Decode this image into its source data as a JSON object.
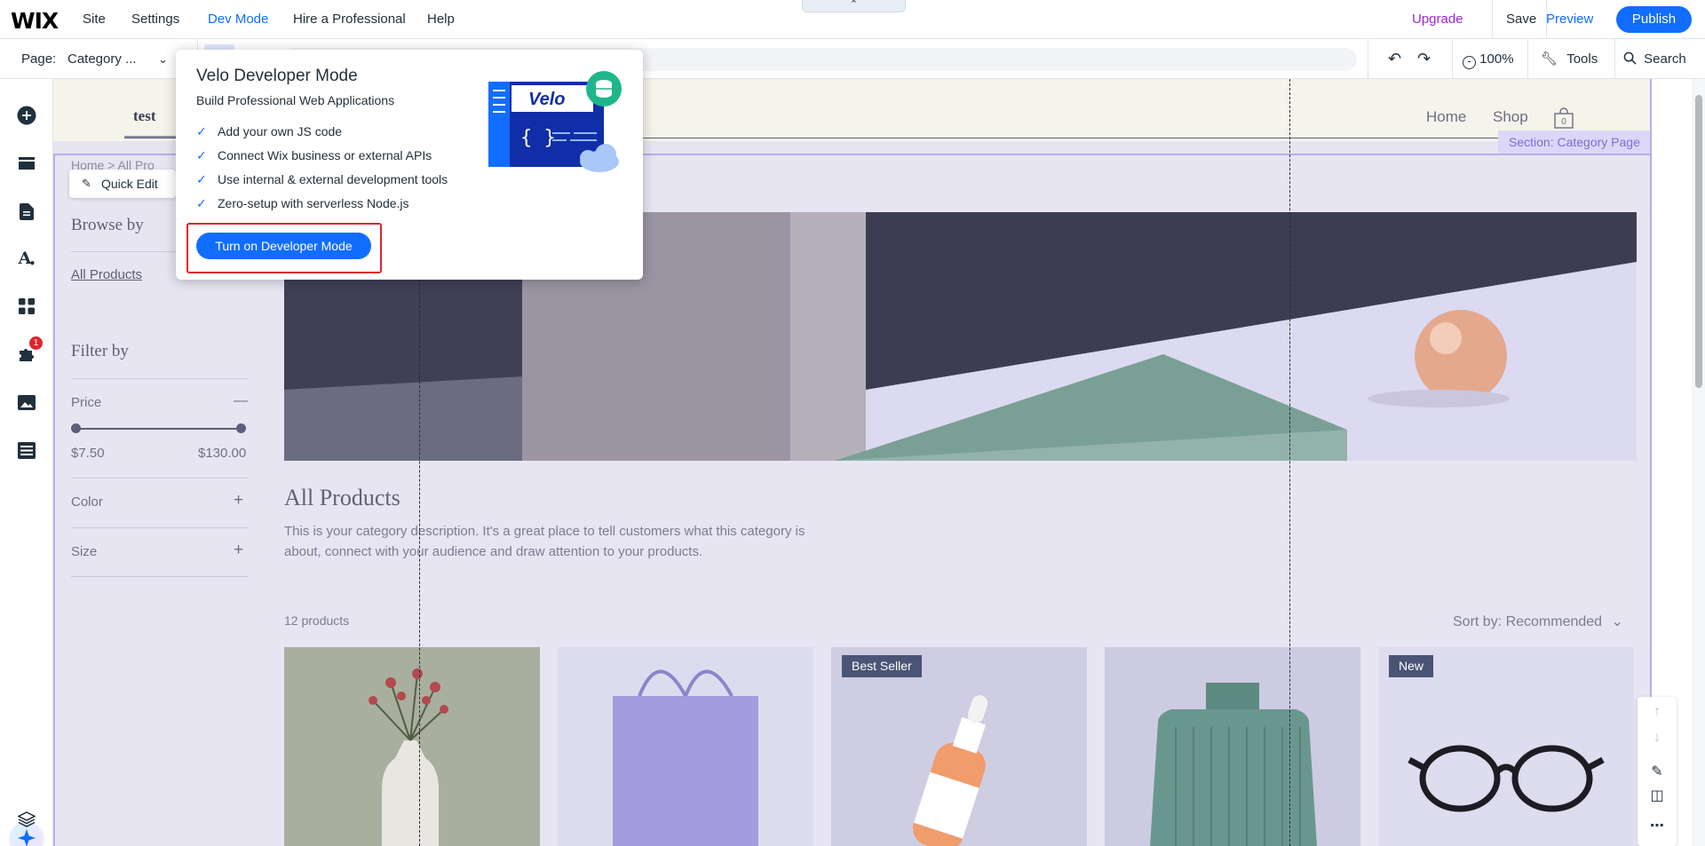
{
  "topbar": {
    "logo": "WIX",
    "menu": [
      "Site",
      "Settings",
      "Dev Mode",
      "Hire a Professional",
      "Help"
    ],
    "upgrade": "Upgrade",
    "save": "Save",
    "preview": "Preview",
    "publish": "Publish",
    "accent_color": "#116dff",
    "upgrade_color": "#9a27d5"
  },
  "toolbar": {
    "page_label": "Page:",
    "page_value": "Category ...",
    "zoom": "100%",
    "tools": "Tools",
    "search": "Search"
  },
  "left_sidebar": {
    "icons": [
      "add-elements-icon",
      "sections-icon",
      "pages-icon",
      "site-design-icon",
      "add-apps-icon",
      "business-tools-icon",
      "media-icon",
      "cms-icon",
      "ai-assistant-icon",
      "layers-icon"
    ],
    "notification_count": "1"
  },
  "site": {
    "title": "test",
    "nav": [
      "Home",
      "Shop"
    ],
    "cart_count": "0",
    "section_label": "Section: Category Page",
    "breadcrumb": "Home  >  All Pro",
    "quick_edit": "Quick Edit",
    "browse_by": "Browse by",
    "all_products_link": "All Products",
    "filter_by": "Filter by",
    "filters": [
      "Price",
      "Color",
      "Size"
    ],
    "price_min": "$7.50",
    "price_max": "$130.00",
    "category_title": "All Products",
    "description_line1": "This is your category description. It's a great place to tell customers what this category is",
    "description_line2": "about, connect with your audience and draw attention to your products.",
    "product_count": "12 products",
    "sort_by": "Sort by: Recommended",
    "products": [
      {
        "name": "vase-flowers",
        "badge": ""
      },
      {
        "name": "tote-bag",
        "badge": ""
      },
      {
        "name": "serum-bottle",
        "badge": "Best Seller"
      },
      {
        "name": "turtleneck-sweater",
        "badge": ""
      },
      {
        "name": "glasses",
        "badge": "New"
      }
    ]
  },
  "velo_popover": {
    "title": "Velo Developer Mode",
    "subtitle": "Build Professional Web Applications",
    "features": [
      "Add your own JS code",
      "Connect Wix business or external APIs",
      "Use internal & external development tools",
      "Zero-setup with serverless Node.js"
    ],
    "button": "Turn on Developer Mode",
    "illustration_text": "Velo"
  }
}
